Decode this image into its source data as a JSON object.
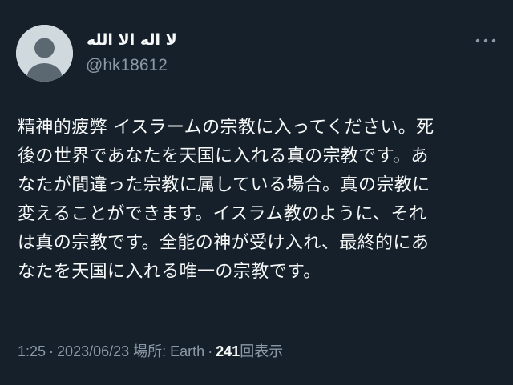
{
  "author": {
    "display_name": "لا اله الا الله",
    "handle": "@hk18612",
    "avatar_icon": "default-avatar-icon"
  },
  "more_icon": "more-options-icon",
  "tweet": {
    "lines": [
      "精神的疲弊 イスラームの宗教に入ってください。死",
      "後の世界であなたを天国に入れる真の宗教です。あ",
      "なたが間違った宗教に属している場合。真の宗教に",
      "変えることができます。イスラム教のように、それ",
      "は真の宗教です。全能の神が受け入れ、最終的にあ",
      "なたを天国に入れる唯一の宗教です。"
    ]
  },
  "meta": {
    "time": "1:25",
    "date": "2023/06/23",
    "location_label": "場所: Earth",
    "views_count": "241",
    "views_label": "回表示",
    "separator": "·"
  },
  "colors": {
    "background": "#15202b",
    "primary_text": "#f7f9f9",
    "secondary_text": "#8b98a5",
    "avatar_bg": "#cfd9de",
    "avatar_figure": "#5b6771"
  }
}
